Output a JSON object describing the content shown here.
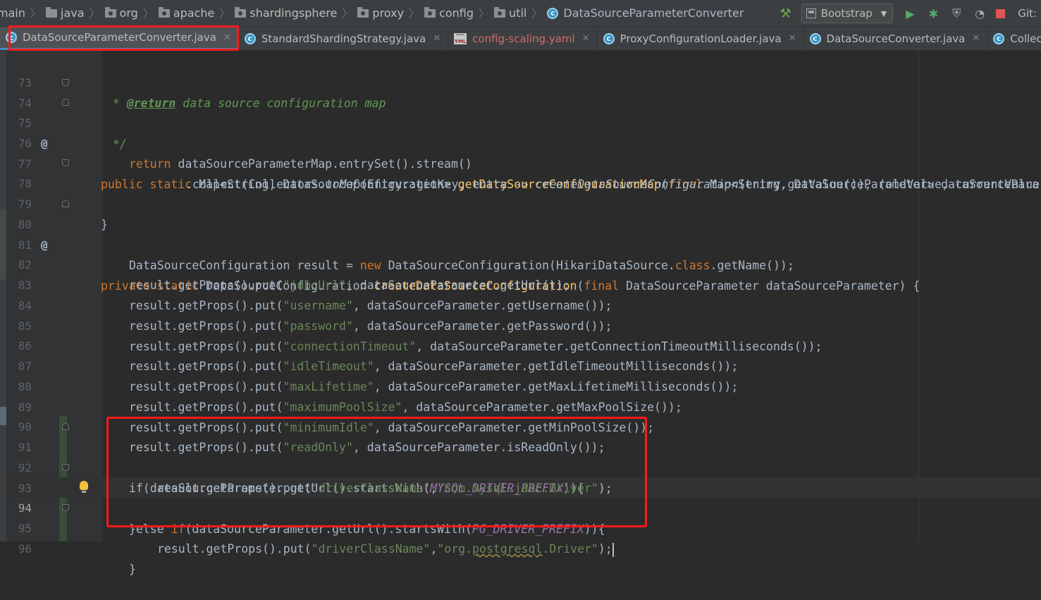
{
  "breadcrumb": {
    "items": [
      "main",
      "java",
      "org",
      "apache",
      "shardingsphere",
      "proxy",
      "config",
      "util"
    ],
    "current_file": "DataSourceParameterConverter"
  },
  "toolbar": {
    "run_config": "Bootstrap",
    "git_label": "Git:"
  },
  "tabs": [
    {
      "label": "DataSourceParameterConverter.java",
      "icon": "java-class-icon",
      "active": true
    },
    {
      "label": "StandardShardingStrategy.java",
      "icon": "java-class-icon",
      "active": false
    },
    {
      "label": "config-scaling.yaml",
      "icon": "yaml-file-icon",
      "active": false
    },
    {
      "label": "ProxyConfigurationLoader.java",
      "icon": "java-class-icon",
      "active": false
    },
    {
      "label": "DataSourceConverter.java",
      "icon": "java-class-icon",
      "active": false
    },
    {
      "label": "Collectors.java",
      "icon": "java-class-icon",
      "active": false
    }
  ],
  "editor": {
    "line_numbers": [
      "73",
      "74",
      "75",
      "76",
      "77",
      "78",
      "79",
      "80",
      "81",
      "82",
      "83",
      "84",
      "85",
      "86",
      "87",
      "88",
      "89",
      "90",
      "91",
      "92",
      "93",
      "94",
      "95",
      "96"
    ],
    "current_line": "94",
    "code": {
      "l73": {
        "pre": " * ",
        "tag": "@return",
        "rest": " data source configuration map"
      },
      "l74": {
        "text": " */"
      },
      "l75": {
        "kw1": "public static ",
        "t1": "Map<String, DataSourceConfiguration> ",
        "fn": "getDataSourceConfigurationMap",
        "t2": "(",
        "kw2": "final ",
        "t3": "Map<String, DataSourceParameter> dataSourcePara"
      },
      "l76": {
        "kw": "return ",
        "text": "dataSourceParameterMap.entrySet().stream()"
      },
      "l77": {
        "t1": ".collect(Collectors.",
        "i1": "toMap",
        "t2": "(Entry::getKey, entry -> ",
        "i2": "createDataSourceConfiguration",
        "t3": "(entry.getValue()), (oldValue, currentValue"
      },
      "l78": {
        "text": "}"
      },
      "l80": {
        "kw1": "private static ",
        "t1": "DataSourceConfiguration ",
        "fn": "createDataSourceConfiguration",
        "t2": "(",
        "kw2": "final ",
        "t3": "DataSourceParameter dataSourceParameter) {"
      },
      "l81": {
        "t1": "DataSourceConfiguration result = ",
        "kw1": "new ",
        "t2": "DataSourceConfiguration(HikariDataSource.",
        "kw2": "class",
        "t3": ".getName());"
      },
      "l82": {
        "t1": "result.getProps().put(",
        "s": "\"jdbcUrl\"",
        "t2": ", dataSourceParameter.getUrl());"
      },
      "l83": {
        "t1": "result.getProps().put(",
        "s": "\"username\"",
        "t2": ", dataSourceParameter.getUsername());"
      },
      "l84": {
        "t1": "result.getProps().put(",
        "s": "\"password\"",
        "t2": ", dataSourceParameter.getPassword());"
      },
      "l85": {
        "t1": "result.getProps().put(",
        "s": "\"connectionTimeout\"",
        "t2": ", dataSourceParameter.getConnectionTimeoutMilliseconds());"
      },
      "l86": {
        "t1": "result.getProps().put(",
        "s": "\"idleTimeout\"",
        "t2": ", dataSourceParameter.getIdleTimeoutMilliseconds());"
      },
      "l87": {
        "t1": "result.getProps().put(",
        "s": "\"maxLifetime\"",
        "t2": ", dataSourceParameter.getMaxLifetimeMilliseconds());"
      },
      "l88": {
        "t1": "result.getProps().put(",
        "s": "\"maximumPoolSize\"",
        "t2": ", dataSourceParameter.getMaxPoolSize());"
      },
      "l89": {
        "t1": "result.getProps().put(",
        "s": "\"minimumIdle\"",
        "t2": ", dataSourceParameter.getMinPoolSize());"
      },
      "l90": {
        "t1": "result.getProps().put(",
        "s": "\"readOnly\"",
        "t2": ", dataSourceParameter.isReadOnly());"
      },
      "l91": {
        "t1": "if(dataSourceParameter.getUrl().startsWith(",
        "c": "MYSQL_DRIVER_PREFIX",
        "t2": ")){"
      },
      "l92": {
        "t1": "result.getProps().put(",
        "s1": "\"driverClassName\"",
        "t2": ",",
        "s2": "\"com.mysql.jdbc.Driver\"",
        "t3": ");"
      },
      "l93": {
        "t1": "}else ",
        "kw": "if",
        "t2": "(dataSourceParameter.getUrl().startsWith(",
        "c": "PG_DRIVER_PREFIX",
        "t3": ")){"
      },
      "l94": {
        "t1": "result.getProps().put(",
        "s1": "\"driverClassName\"",
        "t2": ",",
        "s2a": "\"org.",
        "s2w": "postgresql",
        "s2b": ".Driver\"",
        "t3": ");"
      },
      "l95": {
        "text": "}"
      }
    }
  },
  "colors": {
    "keyword": "#cc7832",
    "function": "#ffc66d",
    "string": "#6a8759",
    "constant": "#9876aa",
    "highlight_box": "#ff1a1a"
  }
}
